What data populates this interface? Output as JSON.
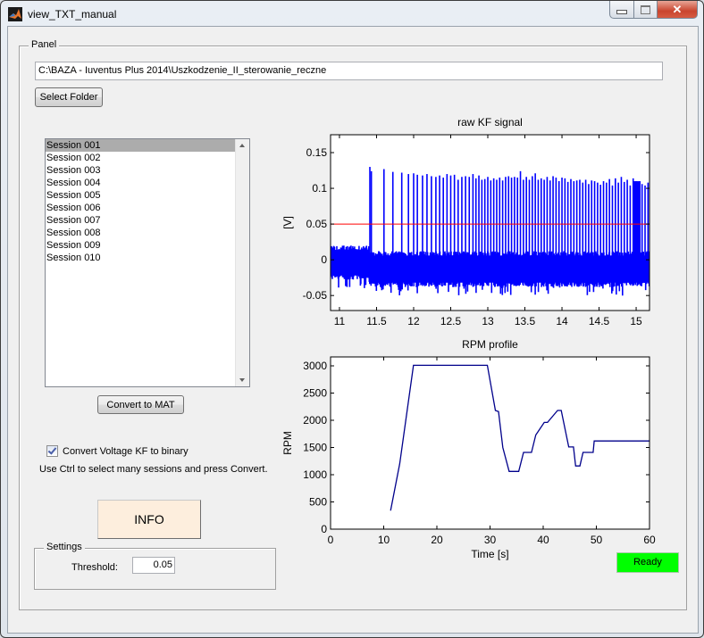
{
  "window": {
    "title": "view_TXT_manual",
    "controls": {
      "minimize": "minimize-icon",
      "maximize": "maximize-icon",
      "close": "close-icon"
    }
  },
  "panel": {
    "legend": "Panel",
    "path_value": "C:\\BAZA - Iuventus Plus 2014\\Uszkodzenie_II_sterowanie_reczne",
    "select_folder_label": "Select Folder",
    "sessions": [
      {
        "label": "Session 001",
        "selected": true
      },
      {
        "label": "Session 002",
        "selected": false
      },
      {
        "label": "Session 003",
        "selected": false
      },
      {
        "label": "Session 004",
        "selected": false
      },
      {
        "label": "Session 005",
        "selected": false
      },
      {
        "label": "Session 006",
        "selected": false
      },
      {
        "label": "Session 007",
        "selected": false
      },
      {
        "label": "Session 008",
        "selected": false
      },
      {
        "label": "Session 009",
        "selected": false
      },
      {
        "label": "Session 010",
        "selected": false
      }
    ],
    "convert_label": "Convert to MAT",
    "checkbox_label": "Convert Voltage KF to binary",
    "checkbox_checked": true,
    "hint": "Use Ctrl to select many sessions and press Convert.",
    "info_label": "INFO",
    "info_color": "#fdeedd",
    "settings": {
      "legend": "Settings",
      "threshold_label": "Threshold:",
      "threshold_value": "0.05"
    },
    "status": {
      "label": "Ready",
      "color": "#00ff00"
    }
  },
  "chart_data": [
    {
      "type": "line",
      "title": "raw KF signal",
      "xlabel": "",
      "ylabel": "[V]",
      "xlim": [
        10.88,
        15.18
      ],
      "ylim": [
        -0.071,
        0.175
      ],
      "xticks": [
        11,
        11.5,
        12,
        12.5,
        13,
        13.5,
        14,
        14.5,
        15
      ],
      "xtick_labels": [
        "11",
        "11.5",
        "12",
        "12.5",
        "13",
        "13.5",
        "14",
        "14.5",
        "15"
      ],
      "yticks": [
        -0.05,
        0,
        0.05,
        0.1,
        0.15
      ],
      "ytick_labels": [
        "-0.05",
        "0",
        "0.05",
        "0.1",
        "0.15"
      ],
      "series_color": "#0000ff",
      "threshold": {
        "value": 0.05,
        "color": "#ff0000"
      },
      "noise_band": {
        "before_11_4": {
          "upper": 0.02,
          "lower": -0.028
        },
        "after_11_4": {
          "upper": 0.012,
          "lower": -0.038
        }
      },
      "spikes": {
        "x": [
          11.41,
          11.43,
          11.6,
          11.72,
          11.84,
          11.93,
          12.0,
          12.05,
          12.12,
          12.18,
          12.24,
          12.3,
          12.35,
          12.4,
          12.45,
          12.5,
          12.55,
          12.6,
          12.65,
          12.7,
          12.75,
          12.8,
          12.84,
          12.88,
          12.92,
          12.96,
          13.0,
          13.04,
          13.08,
          13.12,
          13.16,
          13.2,
          13.24,
          13.28,
          13.32,
          13.36,
          13.4,
          13.44,
          13.48,
          13.52,
          13.56,
          13.6,
          13.64,
          13.68,
          13.72,
          13.76,
          13.8,
          13.84,
          13.88,
          13.92,
          13.96,
          14.0,
          14.04,
          14.08,
          14.12,
          14.16,
          14.2,
          14.24,
          14.28,
          14.32,
          14.36,
          14.4,
          14.44,
          14.48,
          14.52,
          14.56,
          14.6,
          14.64,
          14.68,
          14.72,
          14.76,
          14.8,
          14.84,
          14.88,
          14.92,
          14.96,
          15.0,
          15.04,
          15.08,
          15.12,
          15.16
        ],
        "peak": [
          0.13,
          0.124,
          0.127,
          0.123,
          0.122,
          0.12,
          0.121,
          0.119,
          0.118,
          0.12,
          0.117,
          0.116,
          0.118,
          0.115,
          0.12,
          0.118,
          0.119,
          0.112,
          0.116,
          0.117,
          0.116,
          0.12,
          0.114,
          0.118,
          0.112,
          0.113,
          0.116,
          0.111,
          0.114,
          0.112,
          0.115,
          0.111,
          0.116,
          0.117,
          0.115,
          0.116,
          0.115,
          0.124,
          0.112,
          0.116,
          0.112,
          0.117,
          0.121,
          0.112,
          0.114,
          0.112,
          0.116,
          0.111,
          0.117,
          0.115,
          0.11,
          0.115,
          0.114,
          0.109,
          0.113,
          0.11,
          0.111,
          0.112,
          0.108,
          0.112,
          0.106,
          0.111,
          0.11,
          0.108,
          0.105,
          0.11,
          0.108,
          0.113,
          0.104,
          0.114,
          0.108,
          0.116,
          0.109,
          0.112,
          0.104,
          0.114,
          0.11,
          0.108,
          0.106,
          0.104,
          0.108
        ]
      }
    },
    {
      "type": "line",
      "title": "RPM profile",
      "xlabel": "Time [s]",
      "ylabel": "RPM",
      "xlim": [
        0,
        60
      ],
      "ylim": [
        0,
        3164
      ],
      "xticks": [
        0,
        10,
        20,
        30,
        40,
        50,
        60
      ],
      "xtick_labels": [
        "0",
        "10",
        "20",
        "30",
        "40",
        "50",
        "60"
      ],
      "yticks": [
        0,
        500,
        1000,
        1500,
        2000,
        2500,
        3000
      ],
      "ytick_labels": [
        "0",
        "500",
        "1000",
        "1500",
        "2000",
        "2500",
        "3000"
      ],
      "series_color": "#00008b",
      "x": [
        11.3,
        13.0,
        15.6,
        29.5,
        31.0,
        31.6,
        32.4,
        33.6,
        35.4,
        36.3,
        37.8,
        38.6,
        40.2,
        40.8,
        42.7,
        43.4,
        44.8,
        45.7,
        46.1,
        46.9,
        47.5,
        49.4,
        49.6,
        60.0
      ],
      "y": [
        340,
        1200,
        3010,
        3010,
        2180,
        2160,
        1500,
        1060,
        1060,
        1410,
        1410,
        1730,
        1960,
        1960,
        2180,
        2180,
        1510,
        1510,
        1160,
        1160,
        1410,
        1410,
        1620,
        1620
      ]
    }
  ]
}
